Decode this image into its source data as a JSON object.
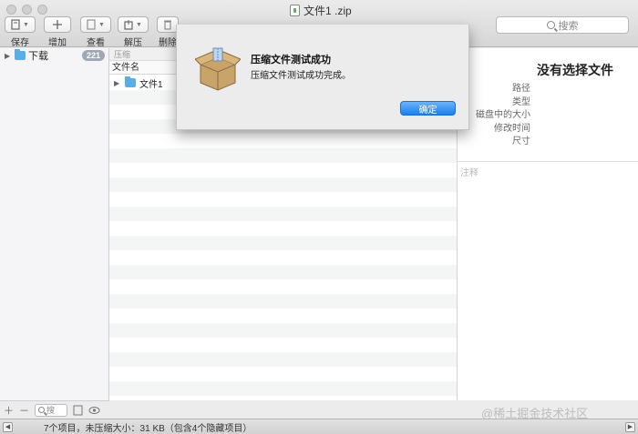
{
  "window": {
    "title": "文件1 .zip"
  },
  "toolbar": {
    "save": "保存",
    "add": "增加",
    "view": "查看",
    "extract": "解压",
    "delete": "删除",
    "search_placeholder": "搜索"
  },
  "sidebar": {
    "items": [
      {
        "label": "下载",
        "count": "221"
      }
    ]
  },
  "filelist": {
    "path": "压缩",
    "column_name": "文件名",
    "rows": [
      {
        "name": "文件1"
      }
    ]
  },
  "info": {
    "title": "没有选择文件",
    "labels": [
      "路径",
      "类型",
      "磁盘中的大小",
      "修改时间",
      "尺寸"
    ],
    "notes_placeholder": "注释"
  },
  "sidebar_footer": {
    "search_placeholder": "搜"
  },
  "status": {
    "text": "7个项目，未压缩大小：31 KB（包含4个隐藏项目）"
  },
  "watermark": "@稀土掘金技术社区",
  "alert": {
    "title": "压缩文件测试成功",
    "message": "压缩文件测试成功完成。",
    "ok_label": "确定"
  },
  "colors": {
    "accent": "#1b7ff0",
    "folder": "#5aaee6",
    "badge": "#a0a7b5"
  }
}
